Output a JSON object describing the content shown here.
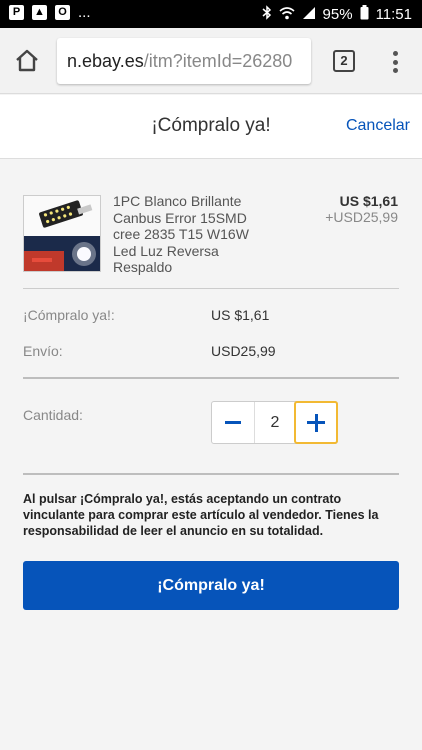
{
  "status_bar": {
    "battery": "95%",
    "time": "11:51",
    "left_icons": [
      "paypal-icon",
      "gallery-icon",
      "outlook-icon"
    ],
    "more": "..."
  },
  "browser": {
    "url_host": "n.ebay.es",
    "url_path": "/itm?itemId=26280",
    "tab_count": "2"
  },
  "header": {
    "title": "¡Cómpralo ya!",
    "cancel_label": "Cancelar"
  },
  "item": {
    "title": "1PC Blanco Brillante Canbus Error 15SMD cree 2835 T15 W16W Led Luz Reversa Respaldo",
    "price": "US $1,61",
    "shipping": "+USD25,99"
  },
  "summary": {
    "buy_now_label": "¡Cómpralo ya!:",
    "buy_now_value": "US $1,61",
    "shipping_label": "Envío:",
    "shipping_value": "USD25,99"
  },
  "quantity": {
    "label": "Cantidad:",
    "value": "2"
  },
  "legal_text": "Al pulsar ¡Cómpralo ya!, estás aceptando un contrato vinculante para comprar este artículo al vendedor. Tienes la responsabilidad de leer el anuncio en su totalidad.",
  "buy_button_label": "¡Cómpralo ya!",
  "colors": {
    "accent_blue": "#0654ba",
    "focus_yellow": "#f2b933"
  }
}
